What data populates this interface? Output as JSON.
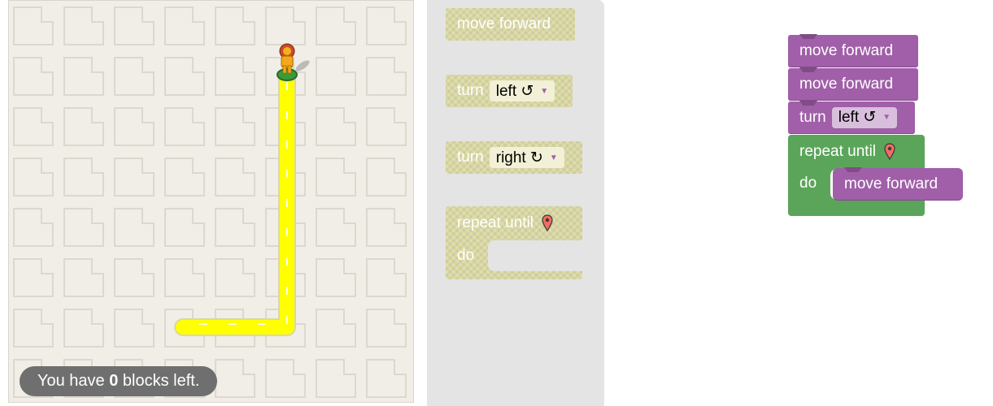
{
  "maze": {
    "capacity_prefix": "You have ",
    "capacity_count": "0",
    "capacity_suffix": " blocks left."
  },
  "toolbox": {
    "move_forward": "move forward",
    "turn_left_label": "turn",
    "turn_left_value": "left ↺",
    "turn_right_label": "turn",
    "turn_right_value": "right ↻",
    "repeat_until": "repeat until",
    "do": "do"
  },
  "workspace": {
    "block1": "move forward",
    "block2": "move forward",
    "turn_label": "turn",
    "turn_value": "left ↺",
    "repeat_until": "repeat until",
    "do": "do",
    "inner_block": "move forward"
  },
  "colors": {
    "motion": "#a05fa8",
    "loop": "#5ba55b",
    "path": "#ffff00",
    "disabled": "#dad79a",
    "marker": "#f36c60"
  },
  "icons": [
    "pegman-icon",
    "goal-marker-icon",
    "dropdown-arrow-icon"
  ]
}
